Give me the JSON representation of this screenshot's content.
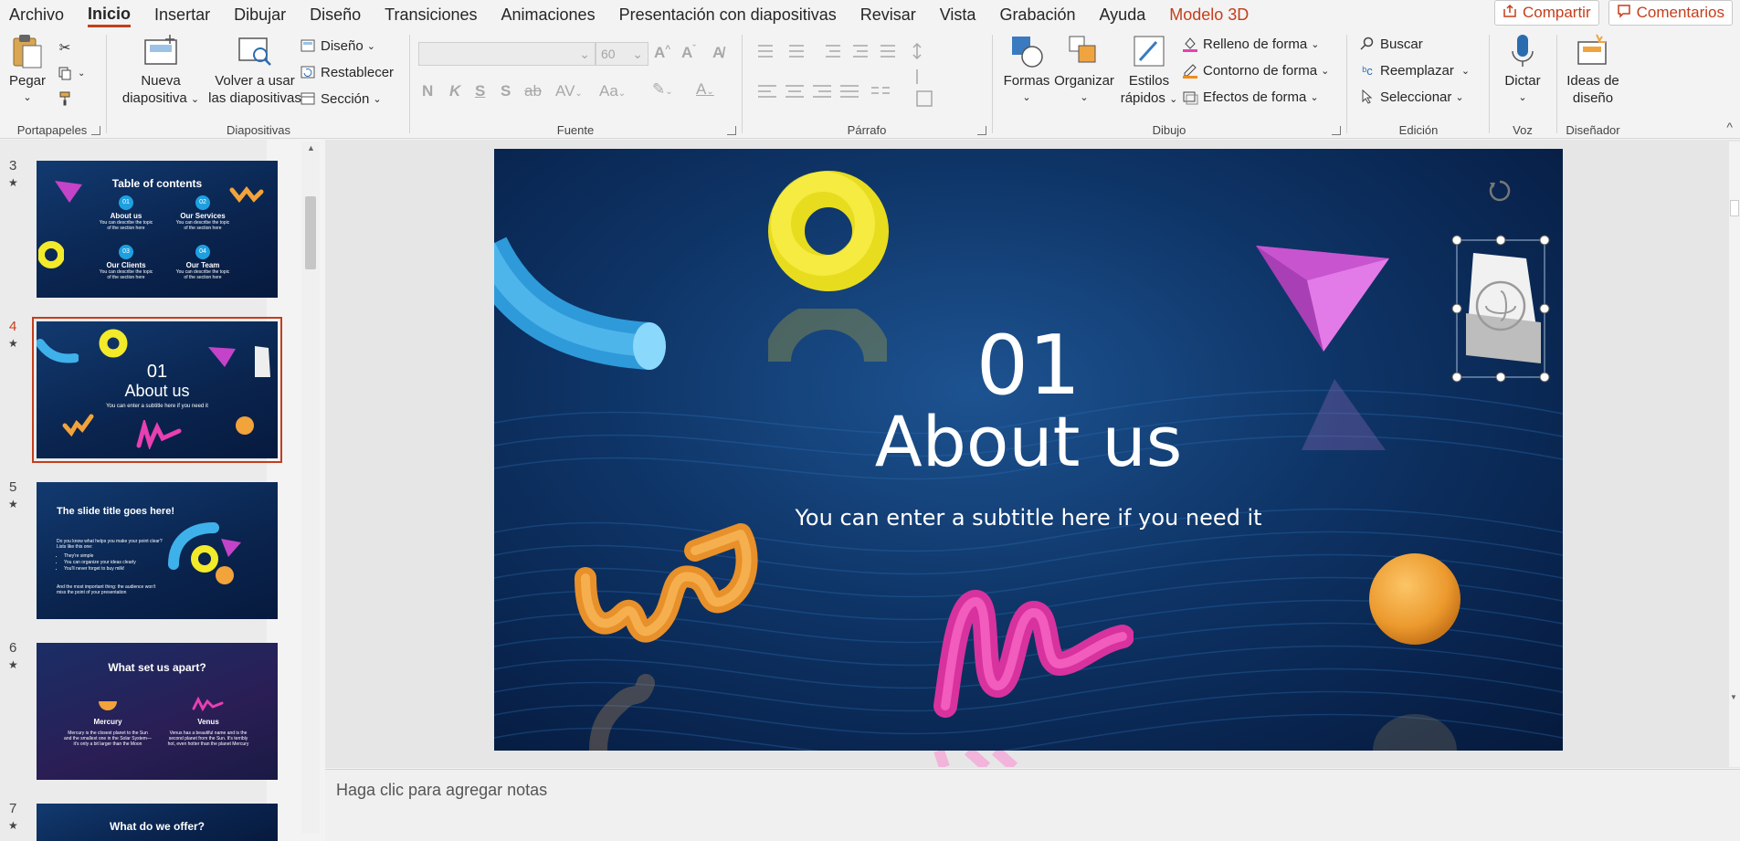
{
  "menu": {
    "items": [
      "Archivo",
      "Inicio",
      "Insertar",
      "Dibujar",
      "Diseño",
      "Transiciones",
      "Animaciones",
      "Presentación con diapositivas",
      "Revisar",
      "Vista",
      "Grabación",
      "Ayuda",
      "Modelo 3D"
    ],
    "share_label": "Compartir",
    "comments_label": "Comentarios"
  },
  "ribbon": {
    "clipboard": {
      "paste": "Pegar",
      "label": "Portapapeles"
    },
    "slides": {
      "new_line1": "Nueva",
      "new_line2": "diapositiva",
      "reuse_line1": "Volver a usar",
      "reuse_line2": "las diapositivas",
      "layout": "Diseño",
      "reset": "Restablecer",
      "section": "Sección",
      "label": "Diapositivas"
    },
    "font": {
      "font_size": "60",
      "label": "Fuente"
    },
    "paragraph": {
      "label": "Párrafo"
    },
    "drawing": {
      "shapes": "Formas",
      "arrange": "Organizar",
      "styles_line1": "Estilos",
      "styles_line2": "rápidos",
      "fill": "Relleno de forma",
      "outline": "Contorno de forma",
      "effects": "Efectos de forma",
      "label": "Dibujo"
    },
    "editing": {
      "find": "Buscar",
      "replace": "Reemplazar",
      "select": "Seleccionar",
      "label": "Edición"
    },
    "voice": {
      "dictate": "Dictar",
      "label": "Voz"
    },
    "designer": {
      "ideas_line1": "Ideas de",
      "ideas_line2": "diseño",
      "label": "Diseñador"
    }
  },
  "thumbnails": [
    {
      "number": "3",
      "title": "Table of contents",
      "items": [
        {
          "num": "01",
          "title": "About us",
          "text": "You can describe the topic of the section here"
        },
        {
          "num": "02",
          "title": "Our Services",
          "text": "You can describe the topic of the section here"
        },
        {
          "num": "03",
          "title": "Our Clients",
          "text": "You can describe the topic of the section here"
        },
        {
          "num": "04",
          "title": "Our Team",
          "text": "You can describe the topic of the section here"
        }
      ]
    },
    {
      "number": "4",
      "num": "01",
      "title": "About us",
      "subtitle": "You can enter a subtitle here if you need it"
    },
    {
      "number": "5",
      "title": "The slide title goes here!",
      "intro": "Do you know what helps you make your point clear? Lists like this one:",
      "bullets": [
        "They're simple",
        "You can organize your ideas clearly",
        "You'll never forget to buy milk!"
      ],
      "outro": "And the most important thing: the audience won't miss the point of your presentation"
    },
    {
      "number": "6",
      "title": "What set us apart?",
      "col1_title": "Mercury",
      "col1_text": "Mercury is the closest planet to the Sun and the smallest one in the Solar System—it's only a bit larger than the Moon",
      "col2_title": "Venus",
      "col2_text": "Venus has a beautiful name and is the second planet from the Sun. It's terribly hot, even hotter than the planet Mercury"
    },
    {
      "number": "7",
      "title": "What do we offer?"
    }
  ],
  "slide": {
    "number": "01",
    "title": "About us",
    "subtitle": "You can enter a subtitle here if you need it"
  },
  "notes_placeholder": "Haga clic para agregar notas",
  "colors": {
    "accent": "#c43e1c",
    "slide_bg": "#0e3466",
    "yellow": "#f3ea2a",
    "cyan": "#3fb1ea",
    "magenta": "#c443c9",
    "orange": "#f2a33a",
    "pink": "#e83fb1"
  }
}
